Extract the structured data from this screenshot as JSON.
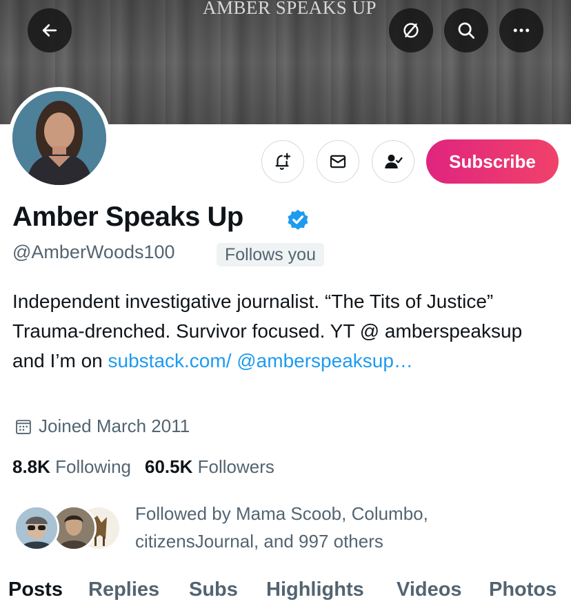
{
  "banner": {
    "text": "AMBER SPEAKS UP",
    "buttons": [
      {
        "icon": "back-arrow-icon"
      },
      {
        "icon": "stop-circle-icon"
      },
      {
        "icon": "search-icon"
      },
      {
        "icon": "more-icon"
      }
    ]
  },
  "profile": {
    "display_name": "Amber Speaks Up",
    "verified": true,
    "handle": "@AmberWoods100",
    "follows_you": "Follows you",
    "subscribe_label": "Subscribe",
    "bio_text": "Independent investigative journalist. “The Tits of Justice” Trauma-drenched. Survivor focused. YT @ amberspeaksup and I’m on ",
    "bio_link": "substack.com/ @amberspeaksup…",
    "joined": "Joined March 2011",
    "following_count": "8.8K",
    "following_label": "Following",
    "followers_count": "60.5K",
    "followers_label": "Followers",
    "followed_by": "Followed by Mama Scoob, Columbo, citizensJournal, and 997 others"
  },
  "tabs": [
    {
      "label": "Posts",
      "active": true
    },
    {
      "label": "Replies",
      "active": false
    },
    {
      "label": "Subs",
      "active": false
    },
    {
      "label": "Highlights",
      "active": false
    },
    {
      "label": "Videos",
      "active": false
    },
    {
      "label": "Photos",
      "active": false
    }
  ],
  "colors": {
    "accent_blue": "#1d9bf0",
    "subscribe_gradient_start": "#e0247f",
    "subscribe_gradient_end": "#f0426a",
    "secondary_text": "#536471"
  }
}
